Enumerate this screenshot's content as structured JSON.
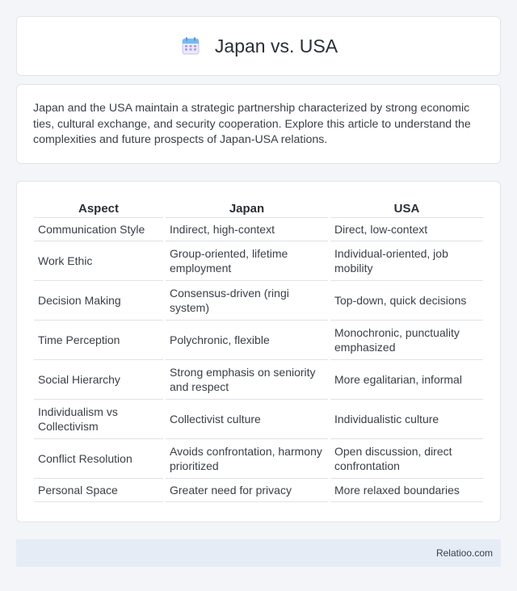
{
  "header": {
    "title": "Japan vs. USA",
    "icon": "calendar-icon"
  },
  "intro": {
    "text": "Japan and the USA maintain a strategic partnership characterized by strong economic ties, cultural exchange, and security cooperation. Explore this article to understand the complexities and future prospects of Japan-USA relations."
  },
  "table": {
    "headers": [
      "Aspect",
      "Japan",
      "USA"
    ],
    "rows": [
      [
        "Communication Style",
        "Indirect, high-context",
        "Direct, low-context"
      ],
      [
        "Work Ethic",
        "Group-oriented, lifetime employment",
        "Individual-oriented, job mobility"
      ],
      [
        "Decision Making",
        "Consensus-driven (ringi system)",
        "Top-down, quick decisions"
      ],
      [
        "Time Perception",
        "Polychronic, flexible",
        "Monochronic, punctuality emphasized"
      ],
      [
        "Social Hierarchy",
        "Strong emphasis on seniority and respect",
        "More egalitarian, informal"
      ],
      [
        "Individualism vs Collectivism",
        "Collectivist culture",
        "Individualistic culture"
      ],
      [
        "Conflict Resolution",
        "Avoids confrontation, harmony prioritized",
        "Open discussion, direct confrontation"
      ],
      [
        "Personal Space",
        "Greater need for privacy",
        "More relaxed boundaries"
      ]
    ]
  },
  "footer": {
    "brand": "Relatioo.com"
  },
  "colors": {
    "background": "#f3f5f9",
    "card": "#ffffff",
    "footer": "#e6ecf5",
    "icon_accent": "#8b7fd4"
  }
}
